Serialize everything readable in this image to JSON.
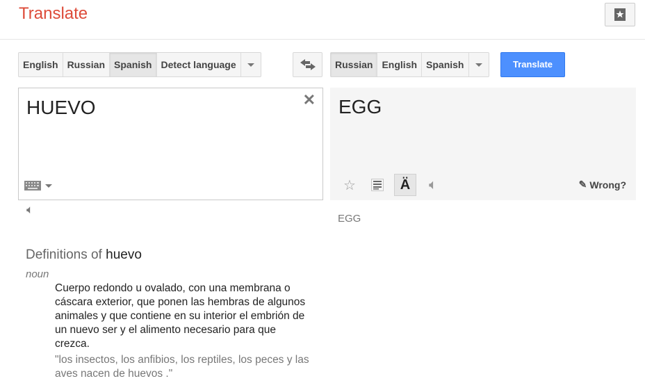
{
  "header": {
    "title": "Translate",
    "bookmark_icon": "phrasebook-icon"
  },
  "source": {
    "languages": [
      {
        "label": "English",
        "selected": false
      },
      {
        "label": "Russian",
        "selected": false
      },
      {
        "label": "Spanish",
        "selected": true
      },
      {
        "label": "Detect language",
        "selected": false
      }
    ],
    "text": "HUEVO"
  },
  "target": {
    "languages": [
      {
        "label": "Russian",
        "selected": true
      },
      {
        "label": "English",
        "selected": false
      },
      {
        "label": "Spanish",
        "selected": false
      }
    ],
    "text": "EGG",
    "wrong_label": "Wrong?",
    "transliteration": "EGG"
  },
  "translate_label": "Translate",
  "accent_color": "#4d90fe",
  "definitions": {
    "heading_prefix": "Definitions of",
    "word": "huevo",
    "part_of_speech": "noun",
    "definition": "Cuerpo redondo u ovalado, con una membrana o cáscara exterior, que ponen las hembras de algunos animales y que contiene en su interior el embrión de un nuevo ser y el alimento necesario para que crezca.",
    "example": "\"los insectos, los anfibios, los reptiles, los peces y las aves nacen de huevos .\""
  }
}
